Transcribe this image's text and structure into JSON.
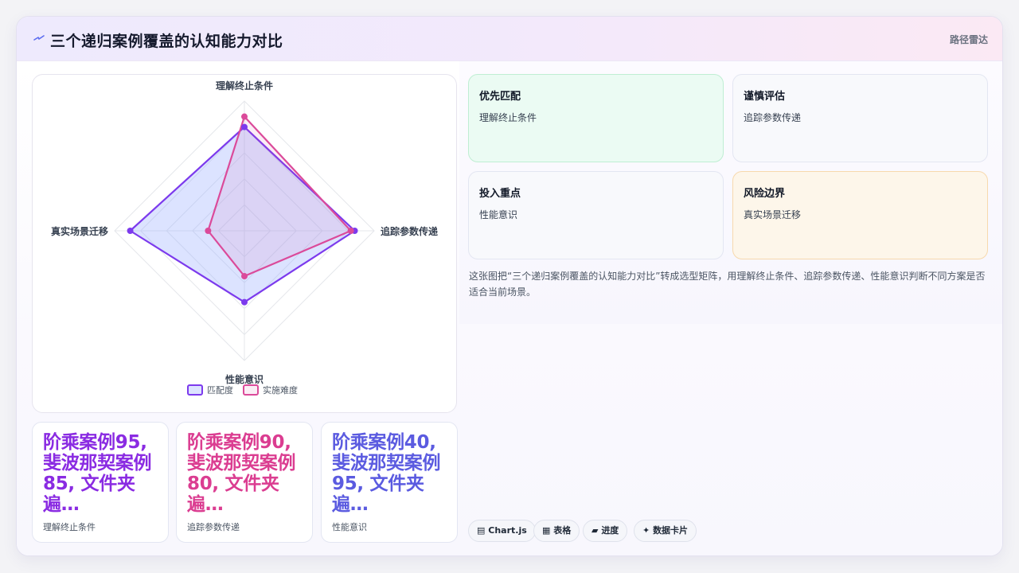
{
  "header": {
    "title": "三个递归案例覆盖的认知能力对比",
    "right_label": "路径雷达"
  },
  "colors": {
    "series1_stroke": "#7c3aed",
    "series1_fill": "rgba(147,168,255,0.32)",
    "series2_stroke": "#db4a9a",
    "series2_fill": "rgba(219,74,154,0.10)",
    "metric1": "#8a2be2",
    "metric2": "#db3d91",
    "metric3": "#5b5be0"
  },
  "chart_data": {
    "type": "radar",
    "axes": [
      "理解终止条件",
      "追踪参数传递",
      "性能意识",
      "真实场景迁移"
    ],
    "range": [
      0,
      100
    ],
    "series": [
      {
        "name": "匹配度",
        "values": [
          80,
          85,
          55,
          88
        ]
      },
      {
        "name": "实施难度",
        "values": [
          88,
          82,
          35,
          28
        ]
      }
    ],
    "legend_position": "bottom",
    "grid": true
  },
  "metrics": [
    {
      "value": "阶乘案例95, 斐波那契案例85, 文件夹遍…",
      "label": "理解终止条件"
    },
    {
      "value": "阶乘案例90, 斐波那契案例80, 文件夹遍…",
      "label": "追踪参数传递"
    },
    {
      "value": "阶乘案例40, 斐波那契案例95, 文件夹遍…",
      "label": "性能意识"
    }
  ],
  "quadrants": [
    {
      "title": "优先匹配",
      "value": "理解终止条件"
    },
    {
      "title": "谨慎评估",
      "value": "追踪参数传递"
    },
    {
      "title": "投入重点",
      "value": "性能意识"
    },
    {
      "title": "风险边界",
      "value": "真实场景迁移"
    }
  ],
  "description": "这张图把“三个递归案例覆盖的认知能力对比”转成选型矩阵，用理解终止条件、追踪参数传递、性能意识判断不同方案是否适合当前场景。",
  "tags": [
    {
      "icon": "chart-icon",
      "glyph": "▤",
      "label": "Chart.js"
    },
    {
      "icon": "table-icon",
      "glyph": "▦",
      "label": "表格"
    },
    {
      "icon": "progress-icon",
      "glyph": "▰",
      "label": "进度"
    },
    {
      "icon": "sparkle-icon",
      "glyph": "✦",
      "label": "数据卡片"
    }
  ]
}
